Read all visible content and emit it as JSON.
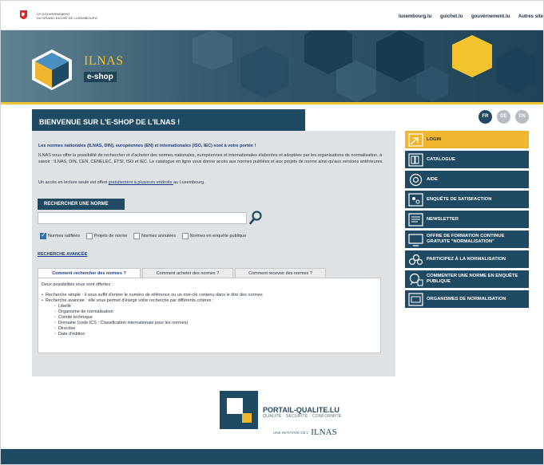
{
  "gov": {
    "text_line1": "LE GOUVERNEMENT",
    "text_line2": "DU GRAND-DUCHÉ DE LUXEMBOURG",
    "links": [
      "luxembourg.lu",
      "guichet.lu",
      "gouvernement.lu",
      "Autres site"
    ]
  },
  "brand": {
    "name": "ILNAS",
    "shop": "e-shop"
  },
  "header": {
    "title": "BIENVENUE SUR L'E-SHOP DE L'ILNAS !",
    "languages": [
      "FR",
      "DE",
      "EN"
    ],
    "active_language": "FR"
  },
  "intro": {
    "title": "Les normes nationales (ILNAS, DIN), européennes (EN) et internationales (ISO, IEC) sont à votre portée !",
    "text": "ILNAS vous offre la possibilité de rechercher et d'acheter des normes nationales, européennes et internationales élaborées et adoptées par les organisations de normalisation, à savoir : ILNAS, DIN, CEN, CENELEC, ETSI, ISO et IEC. Le catalogue en ligne vous donne accès aux normes publiées et aux projets de norme ainsi qu'aux versions antérieures.",
    "free_before": "Un accès en lecture seule est offert ",
    "free_link": "gratuitement à plusieurs endroits ",
    "free_after": "au Luxembourg."
  },
  "search": {
    "label": "RECHERCHER UNE NORME",
    "value": "",
    "placeholder": "",
    "filters": [
      {
        "label": "Normes ratifiées",
        "checked": true
      },
      {
        "label": "Projets de norme",
        "checked": false
      },
      {
        "label": "Normes annulées",
        "checked": false
      },
      {
        "label": "Normes en enquête publique",
        "checked": false
      }
    ],
    "advanced": "RECHERCHE AVANCÉE"
  },
  "tabs": {
    "items": [
      "Comment rechercher des normes ?",
      "Comment acheter des normes ?",
      "Comment recevoir des normes ?"
    ],
    "active": 0,
    "panel": {
      "intro": "Deux possibilités vous sont offertes :",
      "simple": "Recherche simple : il vous suffit d'entrer le numéro de référence ou un mot-clé contenu dans le titre des normes",
      "advanced": "Recherche avancée : elle vous permet d'élargir votre recherche par différents critères :",
      "criteria": [
        "Libellé",
        "Organisme de normalisation",
        "Comité technique",
        "Domaine (code ICS : Classification internationale pour les normes)",
        "Directive",
        "Date d'édition"
      ]
    }
  },
  "menu": [
    {
      "label": "LOGIN",
      "icon": "login-icon"
    },
    {
      "label": "CATALOGUE",
      "icon": "catalogue-icon"
    },
    {
      "label": "AIDE",
      "icon": "help-icon"
    },
    {
      "label": "ENQUÊTE DE SATISFACTION",
      "icon": "survey-icon"
    },
    {
      "label": "NEWSLETTER",
      "icon": "newsletter-icon"
    },
    {
      "label": "OFFRE DE FORMATION CONTINUE GRATUITE \"NORMALISATION\"",
      "icon": "training-icon"
    },
    {
      "label": "PARTICIPEZ À LA NORMALISATION",
      "icon": "participate-icon"
    },
    {
      "label": "COMMENTER UNE NORME EN ENQUÊTE PUBLIQUE",
      "icon": "comment-icon"
    },
    {
      "label": "ORGANISMES DE NORMALISATION",
      "icon": "organizations-icon"
    }
  ],
  "footer": {
    "portal_title": "PORTAIL-QUALITE.LU",
    "portal_sub": "QUALITÉ · SÉCURITÉ · CONFORMITÉ",
    "initiative": "UNE INITIATIVE DE L'",
    "initiative_brand": "ILNAS"
  },
  "colors": {
    "primary": "#1f4a63",
    "accent": "#f0b62e",
    "link": "#1c3a82"
  }
}
